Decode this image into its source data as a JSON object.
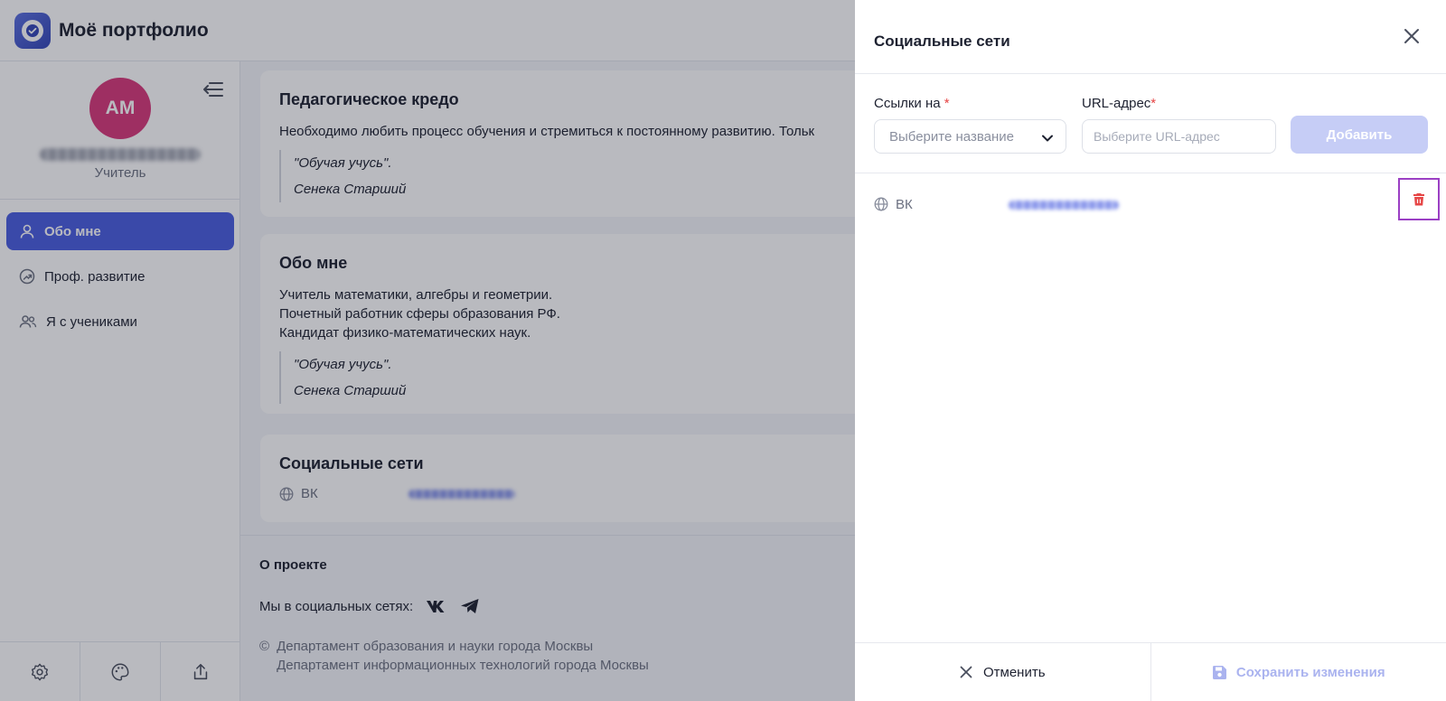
{
  "app": {
    "title": "Моё портфолио"
  },
  "sidebar": {
    "avatar_initials": "АМ",
    "role": "Учитель",
    "items": [
      {
        "label": "Обо мне",
        "icon": "person-icon",
        "active": true
      },
      {
        "label": "Проф. развитие",
        "icon": "growth-icon",
        "active": false
      },
      {
        "label": "Я с учениками",
        "icon": "people-icon",
        "active": false
      }
    ],
    "bottom_icons": [
      "gear-icon",
      "palette-icon",
      "share-icon"
    ]
  },
  "main": {
    "credo": {
      "title": "Педагогическое кредо",
      "text": "Необходимо любить процесс обучения и стремиться к постоянному развитию. Тольк",
      "quote": "\"Обучая учусь\".",
      "author": "Сенека Старший"
    },
    "about": {
      "title": "Обо мне",
      "lines": [
        "Учитель математики, алгебры и геометрии.",
        "Почетный работник сферы образования РФ.",
        "Кандидат физико-математических наук."
      ],
      "quote": "\"Обучая учусь\".",
      "author": "Сенека Старший"
    },
    "social": {
      "title": "Социальные сети",
      "items": [
        {
          "name": "ВК"
        }
      ]
    }
  },
  "footer": {
    "about_project": "О проекте",
    "social_label": "Мы в социальных сетях:",
    "copyright_line1": "Департамент образования и науки города Москвы",
    "copyright_line2": "Департамент информационных технологий города Москвы"
  },
  "drawer": {
    "title": "Социальные сети",
    "links_label": "Ссылки на",
    "links_placeholder": "Выберите название",
    "url_label": "URL-адрес",
    "url_placeholder": "Выберите URL-адрес",
    "add_label": "Добавить",
    "items": [
      {
        "name": "ВК"
      }
    ],
    "cancel_label": "Отменить",
    "save_label": "Сохранить изменения"
  },
  "colors": {
    "accent": "#4a5de0",
    "avatar": "#d8397a",
    "delete": "#e64545",
    "highlight_border": "#9b3fc4"
  }
}
